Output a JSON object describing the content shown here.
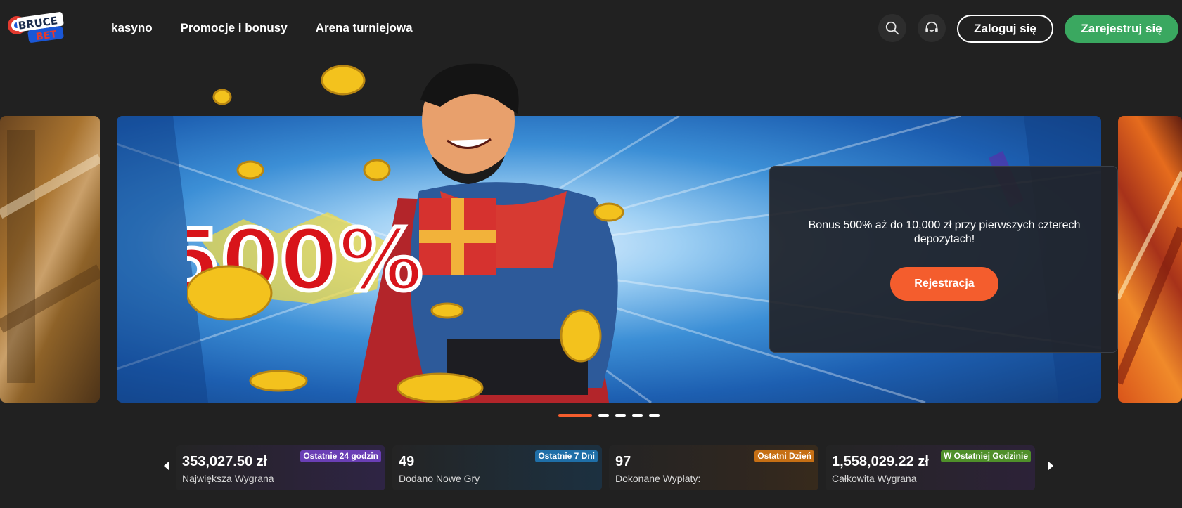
{
  "brand": {
    "logo_text_top": "BRUCE",
    "logo_text_bottom": "BET",
    "colors": {
      "background": "#212121",
      "accent_orange": "#f45d2d",
      "accent_green": "#3aa860",
      "logo_blue": "#1a57d6",
      "logo_red": "#e23a2f"
    }
  },
  "nav": {
    "items": [
      {
        "label": "kasyno"
      },
      {
        "label": "Promocje i bonusy"
      },
      {
        "label": "Arena turniejowa"
      }
    ]
  },
  "header": {
    "search_icon": "search-icon",
    "support_icon": "headset-icon",
    "login_label": "Zaloguj się",
    "register_label": "Zarejestruj się"
  },
  "hero": {
    "badge_text": "500%",
    "promo_text": "Bonus 500% aż do 10,000 zł przy pierwszych czterech depozytach!",
    "cta_label": "Rejestracja",
    "slide_count": 5,
    "active_slide": 1
  },
  "stats": [
    {
      "value": "353,027.50 zł",
      "label": "Największa Wygrana",
      "badge": "Ostatnie 24 godzin",
      "badge_color": "#6a3fb5"
    },
    {
      "value": "49",
      "label": "Dodano Nowe Gry",
      "badge": "Ostatnie 7 Dni",
      "badge_color": "#1f6fa8"
    },
    {
      "value": "97",
      "label": "Dokonane Wypłaty:",
      "badge": "Ostatni Dzień",
      "badge_color": "#c66f14"
    },
    {
      "value": "1,558,029.22 zł",
      "label": "Całkowita Wygrana",
      "badge": "W Ostatniej Godzinie",
      "badge_color": "#4f8f2a"
    }
  ]
}
